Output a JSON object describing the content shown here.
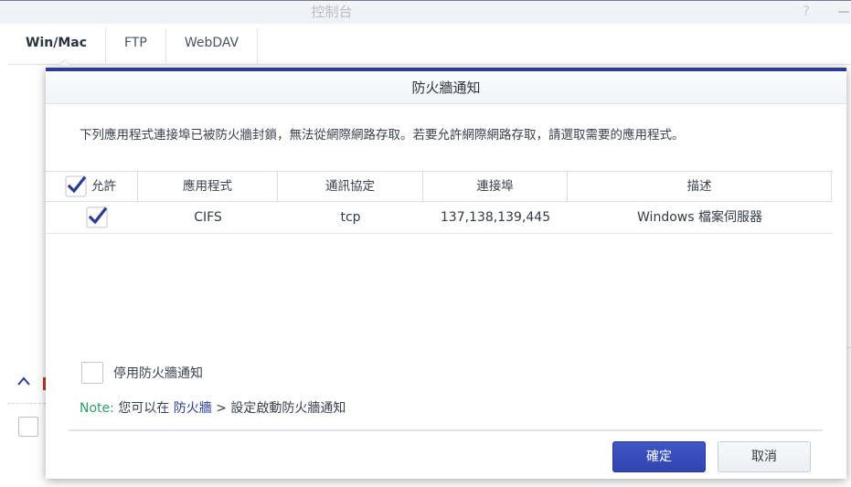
{
  "background_window": {
    "title": "控制台",
    "help_glyph": "?",
    "tabs": [
      {
        "label": "Win/Mac",
        "active": true
      },
      {
        "label": "FTP",
        "active": false
      },
      {
        "label": "WebDAV",
        "active": false
      }
    ]
  },
  "dialog": {
    "title": "防火牆通知",
    "description": "下列應用程式連接埠已被防火牆封鎖，無法從網際網路存取。若要允許網際網路存取，請選取需要的應用程式。",
    "table": {
      "columns": [
        "允許",
        "應用程式",
        "通訊協定",
        "連接埠",
        "描述"
      ],
      "header_checkbox_checked": true,
      "rows": [
        {
          "allowed": true,
          "application": "CIFS",
          "protocol": "tcp",
          "ports": "137,138,139,445",
          "description": "Windows 檔案伺服器"
        }
      ]
    },
    "disable_option": {
      "label": "停用防火牆通知",
      "checked": false
    },
    "note": {
      "key": "Note:",
      "prefix": "您可以在",
      "link": "防火牆",
      "suffix": "> 設定啟動防火牆通知"
    },
    "buttons": {
      "ok": "確定",
      "cancel": "取消"
    }
  },
  "colors": {
    "accent": "#2a3d8f",
    "primary_button": "#3349b8",
    "note_green": "#2f9d69",
    "check_blue": "#2a3d8f"
  }
}
